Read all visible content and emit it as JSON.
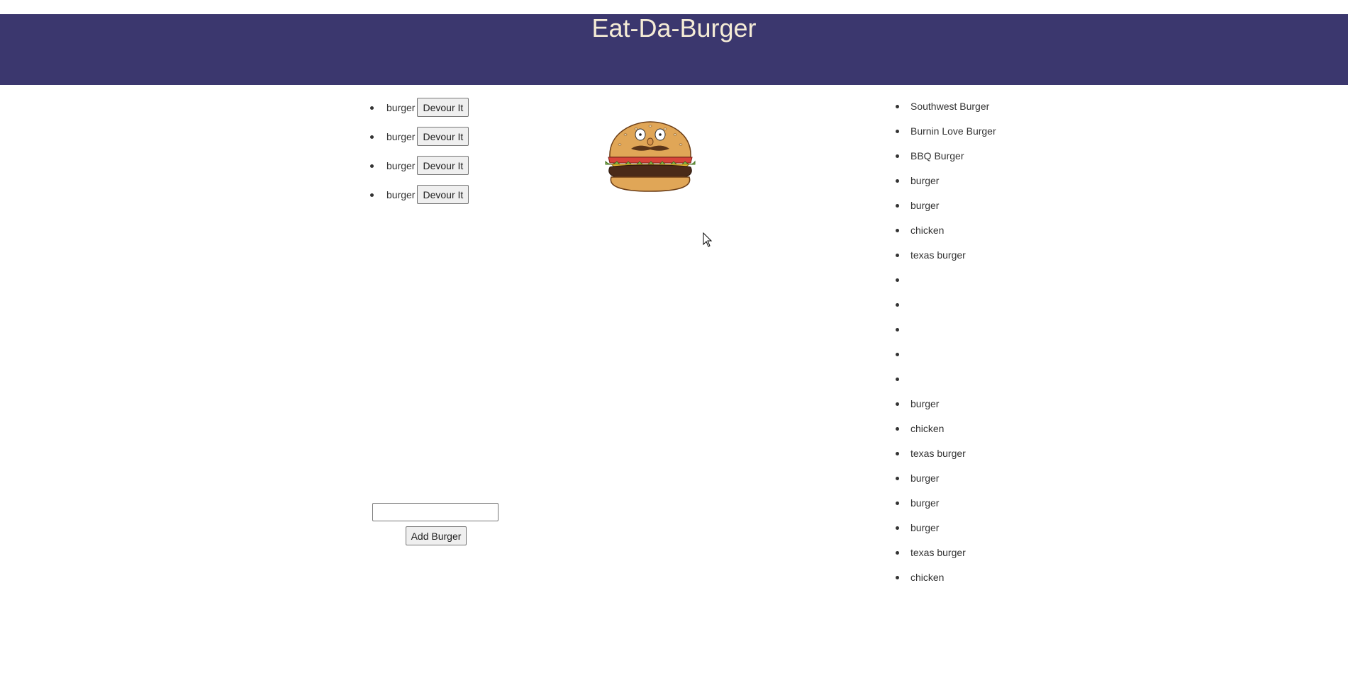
{
  "header": {
    "title": "Eat-Da-Burger"
  },
  "uneaten": {
    "items": [
      {
        "name": "burger",
        "button": "Devour It"
      },
      {
        "name": "burger",
        "button": "Devour It"
      },
      {
        "name": "burger",
        "button": "Devour It"
      },
      {
        "name": "burger",
        "button": "Devour It"
      }
    ]
  },
  "devoured": {
    "items": [
      "Southwest Burger",
      "Burnin Love Burger",
      "BBQ Burger",
      "burger",
      "burger",
      "chicken",
      "texas burger",
      "",
      "",
      "",
      "",
      "",
      "burger",
      "chicken",
      "texas burger",
      "burger",
      "burger",
      "burger",
      "texas burger",
      "chicken"
    ]
  },
  "add_form": {
    "input_value": "",
    "button": "Add Burger"
  },
  "colors": {
    "header_bg": "#3b376e",
    "title": "#f5ecd6"
  },
  "icons": {
    "logo": "burger-face-icon",
    "cursor": "mouse-pointer-icon"
  }
}
